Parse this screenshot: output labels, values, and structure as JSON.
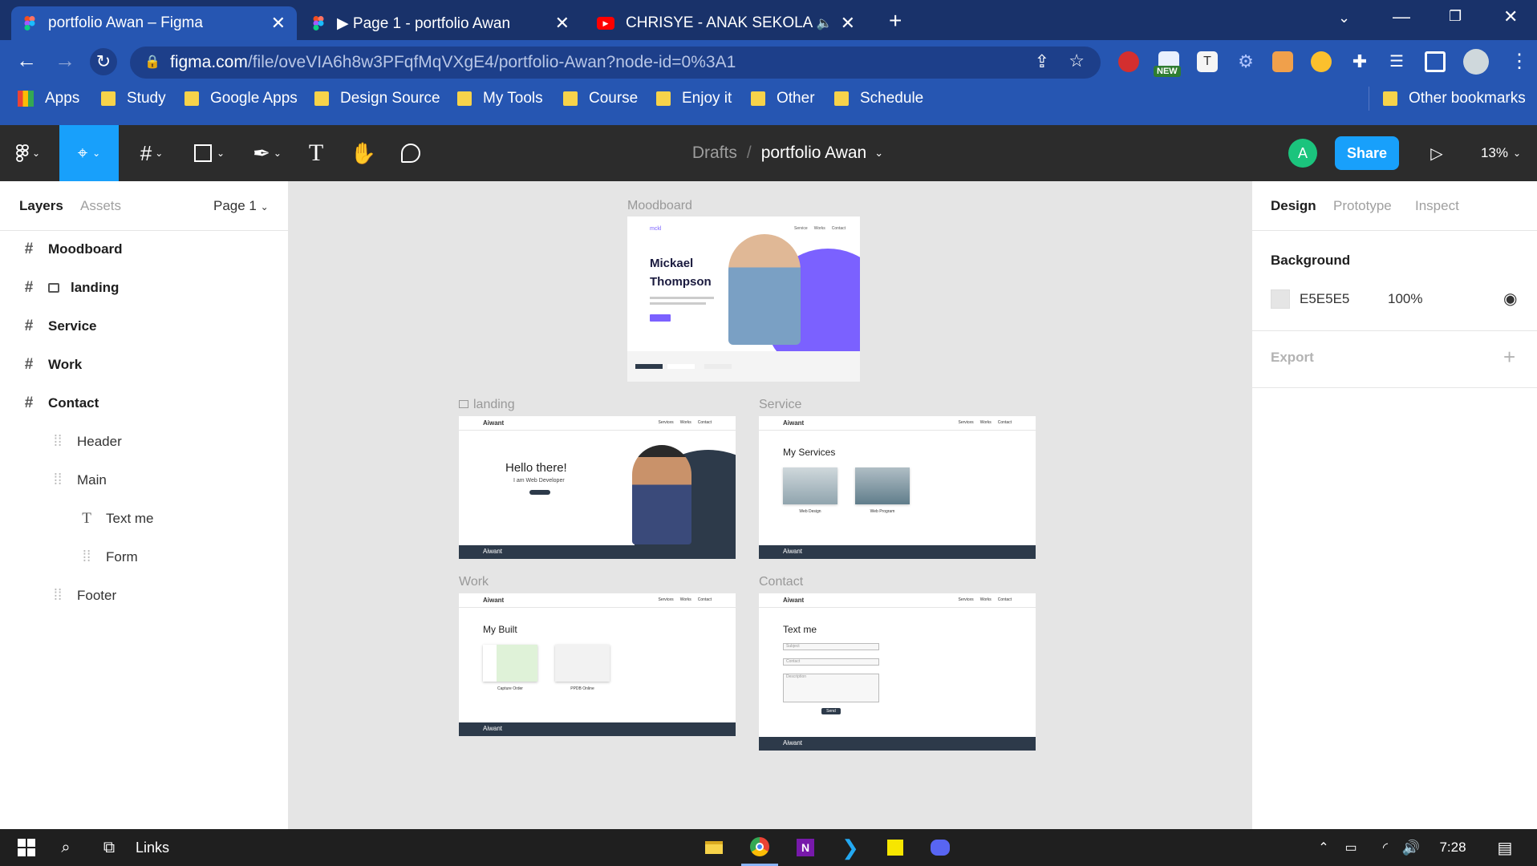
{
  "browser": {
    "tabs": [
      {
        "title": "portfolio Awan – Figma",
        "active": true
      },
      {
        "title": "▶ Page 1 - portfolio Awan",
        "active": false
      },
      {
        "title": "CHRISYE - ANAK SEKOLAH (",
        "active": false
      }
    ],
    "url_host": "figma.com",
    "url_path": "/file/oveVIA6h8w3PFqfMqVXgE4/portfolio-Awan?node-id=0%3A1",
    "ext_badge": "NEW",
    "bookmarks": [
      "Apps",
      "Study",
      "Google Apps",
      "Design Source",
      "My Tools",
      "Course",
      "Enjoy it",
      "Other",
      "Schedule"
    ],
    "other_bookmarks": "Other bookmarks"
  },
  "figma": {
    "breadcrumb_root": "Drafts",
    "breadcrumb_sep": "/",
    "file_name": "portfolio Awan",
    "avatar_initial": "A",
    "share_label": "Share",
    "zoom": "13%"
  },
  "left_panel": {
    "tabs": [
      "Layers",
      "Assets"
    ],
    "page": "Page 1",
    "layers": [
      {
        "name": "Moodboard",
        "icon": "#"
      },
      {
        "name": "landing",
        "icon": "#"
      },
      {
        "name": "Service",
        "icon": "#"
      },
      {
        "name": "Work",
        "icon": "#"
      },
      {
        "name": "Contact",
        "icon": "#"
      },
      {
        "name": "Header",
        "icon": "frame"
      },
      {
        "name": "Main",
        "icon": "frame"
      },
      {
        "name": "Text me",
        "icon": "T"
      },
      {
        "name": "Form",
        "icon": "frame"
      },
      {
        "name": "Footer",
        "icon": "frame"
      }
    ]
  },
  "right_panel": {
    "tabs": [
      "Design",
      "Prototype",
      "Inspect"
    ],
    "background_label": "Background",
    "bg_hex": "E5E5E5",
    "bg_opacity": "100%",
    "export_label": "Export"
  },
  "canvas": {
    "frames": {
      "moodboard": {
        "label": "Moodboard",
        "name_line1": "Mickael",
        "name_line2": "Thompson",
        "logo": "mckl",
        "nav": [
          "Service",
          "Works",
          "Contact"
        ]
      },
      "landing": {
        "label": "landing",
        "brand": "Aiwant",
        "heading": "Hello there!",
        "sub": "I am Web Developer",
        "nav": [
          "Services",
          "Works",
          "Contact"
        ]
      },
      "service": {
        "label": "Service",
        "brand": "Aiwant",
        "heading": "My Services",
        "items": [
          "Web Design",
          "Web Program"
        ],
        "nav": [
          "Services",
          "Works",
          "Contact"
        ]
      },
      "work": {
        "label": "Work",
        "brand": "Aiwant",
        "heading": "My Built",
        "items": [
          "Capture Order",
          "PPDB Online"
        ],
        "nav": [
          "Services",
          "Works",
          "Contact"
        ]
      },
      "contact": {
        "label": "Contact",
        "brand": "Aiwant",
        "heading": "Text me",
        "fields": [
          "Subject",
          "Contact",
          "Description"
        ],
        "send": "Send",
        "nav": [
          "Services",
          "Works",
          "Contact"
        ]
      }
    },
    "help": "?"
  },
  "taskbar": {
    "links_label": "Links",
    "time": "7:28"
  },
  "colors": {
    "figma_dark": "#2c2c2c",
    "accent_blue": "#18a0fb",
    "avatar_green": "#1bc47d",
    "chrome_tab": "#2656b2",
    "footer_dark": "#2d3a4a",
    "purple": "#7b61ff"
  }
}
